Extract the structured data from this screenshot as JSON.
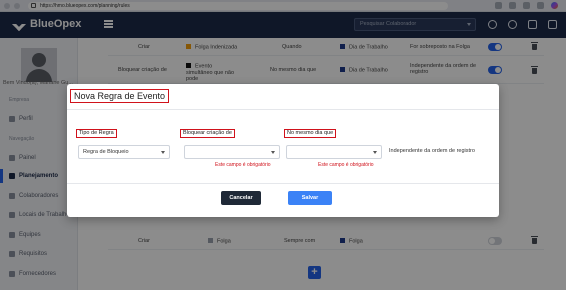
{
  "browser": {
    "url": "https://hmo.blueopex.com/planning/rules"
  },
  "header": {
    "brand": "BlueOpex",
    "collaborator_placeholder": "Pesquisar Colaborador"
  },
  "sidebar": {
    "welcome": "Bem Vindo(a), Mariane Gu...",
    "section_company": "Empresa",
    "profile": "Perfil",
    "section_nav": "Navegação",
    "items": [
      "Painel",
      "Planejamento",
      "Colaboradores",
      "Locais de Trabalho",
      "Equipes",
      "Requisitos",
      "Fornecedores"
    ]
  },
  "bg_rows": [
    {
      "col1": "Criar",
      "col2": "Folga Indenizada",
      "col3": "Quando",
      "col4": "Dia de Trabalho",
      "col5": "For sobreposto na Folga",
      "on": true
    },
    {
      "col1": "Bloquear criação de",
      "col2": "Evento simultâneo que não pode",
      "col3": "No mesmo dia que",
      "col4": "Dia de Trabalho",
      "col5": "Independente da ordem de registro",
      "on": true
    },
    {
      "col1": "Criar",
      "col2": "Folga",
      "col3": "Sempre com",
      "col4": "Folga",
      "col5": "",
      "on": false
    }
  ],
  "modal": {
    "title": "Nova Regra de Evento",
    "rule_type_label": "Tipo de Regra",
    "rule_type_value": "Regra de Bloqueio",
    "block_label": "Bloquear criação de",
    "block_value": "",
    "same_day_label": "No mesmo dia que",
    "same_day_value": "",
    "required_error": "Este campo é obrigatório",
    "independent_text": "Independente da ordem de registro",
    "cancel": "Cancelar",
    "save": "Salvar"
  },
  "colors": {
    "brand": "#1c2a4a",
    "accent": "#2563eb",
    "error": "#d0121b",
    "chip_orange": "#f59e0b",
    "chip_navy": "#1e3a8a",
    "chip_gray": "#9ca3af"
  }
}
